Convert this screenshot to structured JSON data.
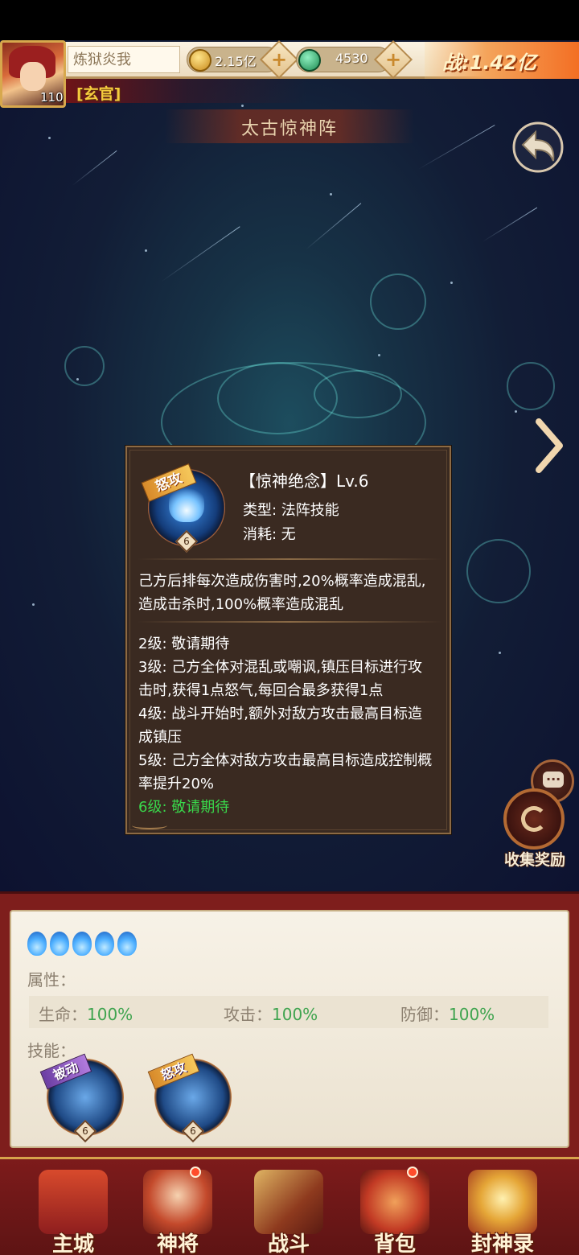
{
  "header": {
    "player_name": "炼狱炎我",
    "level": "110",
    "rank": "[玄官]",
    "gold": "2.15亿",
    "jade": "4530",
    "power": "战:1.42亿"
  },
  "page_title": "太古惊神阵",
  "skill_popup": {
    "tag": "怒攻",
    "level_badge": "6",
    "name": "【惊神绝念】Lv.6",
    "type": "类型: 法阵技能",
    "cost": "消耗: 无",
    "description": [
      "己方后排每次造成伤害时,20%概率造成混乱,",
      "造成击杀时,100%概率造成混乱"
    ],
    "levels": [
      "2级: 敬请期待",
      "3级: 己方全体对混乱或嘲讽,镇压目标进行攻",
      "击时,获得1点怒气,每回合最多获得1点",
      "4级: 战斗开始时,额外对敌方攻击最高目标造",
      "成镇压",
      "5级: 己方全体对敌方攻击最高目标造成控制概",
      "率提升20%"
    ],
    "current_level": "6级: 敬请期待"
  },
  "collect_reward": "收集奖励",
  "info_panel": {
    "attr_label": "属性：",
    "stats": [
      {
        "label": "生命：",
        "value": "100%"
      },
      {
        "label": "攻击：",
        "value": "100%"
      },
      {
        "label": "防御：",
        "value": "100%"
      }
    ],
    "skills_label": "技能：",
    "skills": [
      {
        "tag": "被动",
        "level": "6"
      },
      {
        "tag": "怒攻",
        "level": "6"
      }
    ]
  },
  "nav": [
    {
      "label": "主城"
    },
    {
      "label": "神将"
    },
    {
      "label": "战斗"
    },
    {
      "label": "背包"
    },
    {
      "label": "封神录"
    }
  ],
  "colors": {
    "accent_green": "#39d84b",
    "panel_red": "#7e1e1c",
    "popup_bg": "#3a2a21"
  }
}
